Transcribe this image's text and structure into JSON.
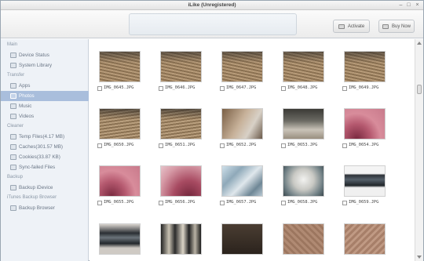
{
  "window": {
    "title": "iLike (Unregistered)"
  },
  "toolbar": {
    "activate_label": "Activate",
    "buy_label": "Buy Now"
  },
  "sidebar": {
    "sections": {
      "main": "Main",
      "transfer": "Transfer",
      "cleaner": "Cleaner",
      "backup": "Backup",
      "itunes": "iTunes Backup Browser"
    },
    "items": {
      "device_status": "Device Status",
      "system_library": "System Library",
      "apps": "Apps",
      "photos": "Photos",
      "music": "Music",
      "videos": "Videos",
      "temp_files": "Temp Files(4.17 MB)",
      "caches": "Caches(301.57 MB)",
      "cookies": "Cookies(33.87 KB)",
      "sync_failed": "Sync-failed Files",
      "backup_idevice": "Backup iDevice",
      "backup_browser": "Backup Browser"
    },
    "selected": "photos"
  },
  "photos": [
    {
      "name": "IMG_0645.JPG",
      "thumb": "warriors"
    },
    {
      "name": "IMG_0646.JPG",
      "thumb": "warriors"
    },
    {
      "name": "IMG_0647.JPG",
      "thumb": "warriors"
    },
    {
      "name": "IMG_0648.JPG",
      "thumb": "warriors"
    },
    {
      "name": "IMG_0649.JPG",
      "thumb": "warriors"
    },
    {
      "name": "IMG_0650.JPG",
      "thumb": "warriors2"
    },
    {
      "name": "IMG_0651.JPG",
      "thumb": "warriors2"
    },
    {
      "name": "IMG_0652.JPG",
      "thumb": "closeup"
    },
    {
      "name": "IMG_0653.JPG",
      "thumb": "crowd"
    },
    {
      "name": "IMG_0654.JPG",
      "thumb": "pink"
    },
    {
      "name": "IMG_0655.JPG",
      "thumb": "pink"
    },
    {
      "name": "IMG_0656.JPG",
      "thumb": "pink2"
    },
    {
      "name": "IMG_0657.JPG",
      "thumb": "glass"
    },
    {
      "name": "IMG_0658.JPG",
      "thumb": "vase"
    },
    {
      "name": "IMG_0659.JPG",
      "thumb": "ring"
    },
    {
      "name": "",
      "thumb": "ring2"
    },
    {
      "name": "",
      "thumb": "statues"
    },
    {
      "name": "",
      "thumb": "dark"
    },
    {
      "name": "",
      "thumb": "floor"
    },
    {
      "name": "",
      "thumb": "floor2"
    }
  ]
}
